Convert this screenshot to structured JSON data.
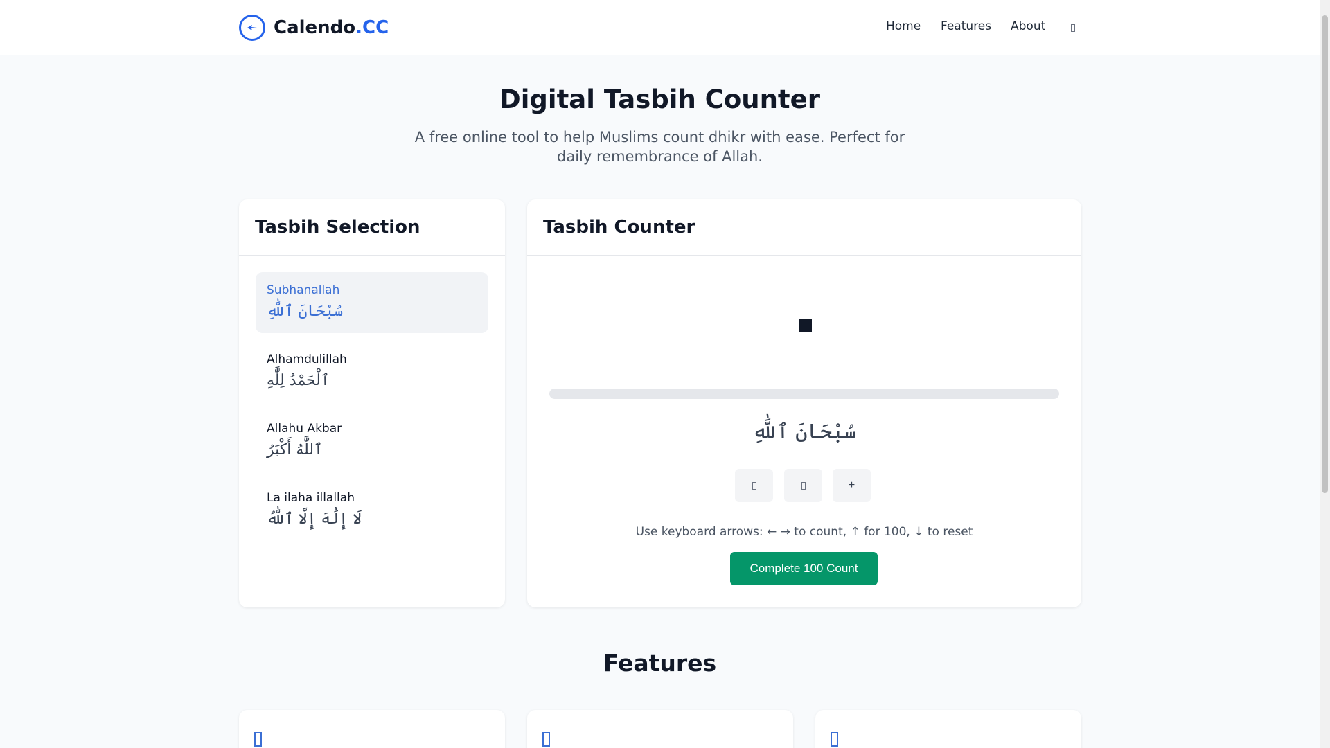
{
  "header": {
    "brand_name": "Calendo",
    "brand_tld": ".CC",
    "nav": {
      "home": "Home",
      "features": "Features",
      "about": "About"
    },
    "theme_toggle_icon": "moon-icon"
  },
  "hero": {
    "title": "Digital Tasbih Counter",
    "subtitle": "A free online tool to help Muslims count dhikr with ease. Perfect for daily remembrance of Allah."
  },
  "selection": {
    "title": "Tasbih Selection",
    "items": [
      {
        "name": "Subhanallah",
        "arabic": "سُبْحَانَ ٱللَّٰهِ",
        "active": true
      },
      {
        "name": "Alhamdulillah",
        "arabic": "ٱلْحَمْدُ لِلَّٰهِ",
        "active": false
      },
      {
        "name": "Allahu Akbar",
        "arabic": "ٱللَّٰهُ أَكْبَرُ",
        "active": false
      },
      {
        "name": "La ilaha illallah",
        "arabic": "لَا إِلَٰهَ إِلَّا ٱللَّٰهُ",
        "active": false
      }
    ]
  },
  "counter": {
    "title": "Tasbih Counter",
    "progress": 0,
    "current_arabic": "سُبْحَانَ ٱللَّٰهِ",
    "buttons": {
      "reset_icon": "reset-icon",
      "sound_icon": "sound-icon",
      "increment_label": "+"
    },
    "hint": "Use keyboard arrows: ← → to count, ↑ for 100, ↓ to reset",
    "complete_label": "Complete 100 Count"
  },
  "features": {
    "title": "Features"
  },
  "colors": {
    "accent": "#2563eb",
    "success": "#059669"
  }
}
